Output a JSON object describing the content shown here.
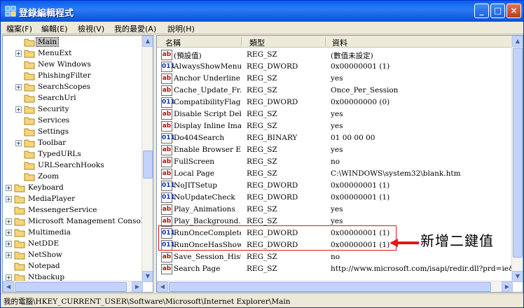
{
  "window": {
    "title": "登錄編輯程式",
    "buttons": {
      "minimize": "_",
      "maximize": "□",
      "close": "×"
    }
  },
  "menubar": [
    "檔案(F)",
    "編輯(E)",
    "檢視(V)",
    "我的最愛(A)",
    "說明(H)"
  ],
  "tree": {
    "items": [
      {
        "label": "Main",
        "indent": 2,
        "expander": false,
        "selected": true
      },
      {
        "label": "MenuExt",
        "indent": 2,
        "expander": true
      },
      {
        "label": "New Windows",
        "indent": 2,
        "expander": false
      },
      {
        "label": "PhishingFilter",
        "indent": 2,
        "expander": false
      },
      {
        "label": "SearchScopes",
        "indent": 2,
        "expander": true
      },
      {
        "label": "SearchUrl",
        "indent": 2,
        "expander": false
      },
      {
        "label": "Security",
        "indent": 2,
        "expander": true
      },
      {
        "label": "Services",
        "indent": 2,
        "expander": false
      },
      {
        "label": "Settings",
        "indent": 2,
        "expander": false
      },
      {
        "label": "Toolbar",
        "indent": 2,
        "expander": true
      },
      {
        "label": "TypedURLs",
        "indent": 2,
        "expander": false
      },
      {
        "label": "URLSearchHooks",
        "indent": 2,
        "expander": false
      },
      {
        "label": "Zoom",
        "indent": 2,
        "expander": false
      },
      {
        "label": "Keyboard",
        "indent": 1,
        "expander": true
      },
      {
        "label": "MediaPlayer",
        "indent": 1,
        "expander": true
      },
      {
        "label": "MessengerService",
        "indent": 1,
        "expander": false
      },
      {
        "label": "Microsoft Management Console",
        "indent": 1,
        "expander": true
      },
      {
        "label": "Multimedia",
        "indent": 1,
        "expander": true
      },
      {
        "label": "NetDDE",
        "indent": 1,
        "expander": true
      },
      {
        "label": "NetShow",
        "indent": 1,
        "expander": true
      },
      {
        "label": "Notepad",
        "indent": 1,
        "expander": false
      },
      {
        "label": "Ntbackup",
        "indent": 1,
        "expander": true
      }
    ]
  },
  "list": {
    "headers": {
      "name": "名稱",
      "type": "類型",
      "data": "資料"
    },
    "rows": [
      {
        "name": "(預設值)",
        "type": "REG_SZ",
        "data": "(數值未設定)",
        "kind": "sz"
      },
      {
        "name": "AlwaysShowMenus",
        "type": "REG_DWORD",
        "data": "0x00000001 (1)",
        "kind": "num"
      },
      {
        "name": "Anchor Underline",
        "type": "REG_SZ",
        "data": "yes",
        "kind": "sz"
      },
      {
        "name": "Cache_Update_Fr...",
        "type": "REG_SZ",
        "data": "Once_Per_Session",
        "kind": "sz"
      },
      {
        "name": "CompatibilityFlags",
        "type": "REG_DWORD",
        "data": "0x00000000 (0)",
        "kind": "num"
      },
      {
        "name": "Disable Script Deb...",
        "type": "REG_SZ",
        "data": "yes",
        "kind": "sz"
      },
      {
        "name": "Display Inline Ima...",
        "type": "REG_SZ",
        "data": "yes",
        "kind": "sz"
      },
      {
        "name": "Do404Search",
        "type": "REG_BINARY",
        "data": "01 00 00 00",
        "kind": "num"
      },
      {
        "name": "Enable Browser E...",
        "type": "REG_SZ",
        "data": "yes",
        "kind": "sz"
      },
      {
        "name": "FullScreen",
        "type": "REG_SZ",
        "data": "no",
        "kind": "sz"
      },
      {
        "name": "Local Page",
        "type": "REG_SZ",
        "data": "C:\\WINDOWS\\system32\\blank.htm",
        "kind": "sz"
      },
      {
        "name": "NoJITSetup",
        "type": "REG_DWORD",
        "data": "0x00000001 (1)",
        "kind": "num"
      },
      {
        "name": "NoUpdateCheck",
        "type": "REG_DWORD",
        "data": "0x00000001 (1)",
        "kind": "num"
      },
      {
        "name": "Play_Animations",
        "type": "REG_SZ",
        "data": "yes",
        "kind": "sz"
      },
      {
        "name": "Play_Background...",
        "type": "REG_SZ",
        "data": "yes",
        "kind": "sz"
      },
      {
        "name": "RunOnceComplete",
        "type": "REG_DWORD",
        "data": "0x00000001 (1)",
        "kind": "num"
      },
      {
        "name": "RunOnceHasShown",
        "type": "REG_DWORD",
        "data": "0x00000001 (1)",
        "kind": "num"
      },
      {
        "name": "Save_Session_Hist...",
        "type": "REG_SZ",
        "data": "no",
        "kind": "sz"
      },
      {
        "name": "Search Page",
        "type": "REG_SZ",
        "data": "http://www.microsoft.com/isapi/redir.dll?prd=ie&ar=iesearch",
        "kind": "sz"
      }
    ]
  },
  "icons": {
    "sz": "ab",
    "num": "011"
  },
  "statusbar": {
    "path": "我的電腦\\HKEY_CURRENT_USER\\Software\\Microsoft\\Internet Explorer\\Main"
  },
  "annotation": {
    "text": "新增二鍵值",
    "color": "#e01818"
  }
}
